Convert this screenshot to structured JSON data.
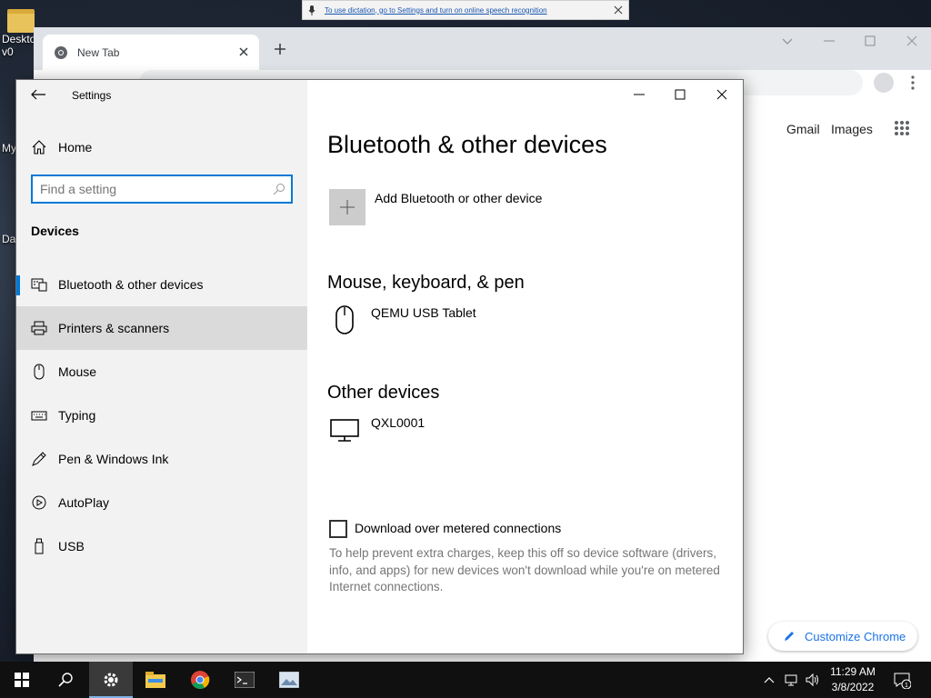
{
  "desktop": {
    "icons": [
      {
        "label": "Deskto\nv0"
      },
      {
        "label": "My"
      },
      {
        "label": "Da"
      }
    ]
  },
  "dictation_banner": {
    "text": "To use dictation, go to Settings and turn on online speech recognition"
  },
  "chrome": {
    "tab_title": "New Tab",
    "links": {
      "gmail": "Gmail",
      "images": "Images"
    },
    "customize_label": "Customize Chrome"
  },
  "settings": {
    "window_title": "Settings",
    "home_label": "Home",
    "search_placeholder": "Find a setting",
    "section_heading": "Devices",
    "nav": [
      {
        "label": "Bluetooth & other devices",
        "icon": "bluetooth-devices-icon"
      },
      {
        "label": "Printers & scanners",
        "icon": "printer-icon"
      },
      {
        "label": "Mouse",
        "icon": "mouse-icon"
      },
      {
        "label": "Typing",
        "icon": "keyboard-icon"
      },
      {
        "label": "Pen & Windows Ink",
        "icon": "pen-icon"
      },
      {
        "label": "AutoPlay",
        "icon": "autoplay-icon"
      },
      {
        "label": "USB",
        "icon": "usb-icon"
      }
    ],
    "page_title": "Bluetooth & other devices",
    "add_device_label": "Add Bluetooth or other device",
    "mouse_section": {
      "heading": "Mouse, keyboard, & pen",
      "device": "QEMU USB Tablet"
    },
    "other_section": {
      "heading": "Other devices",
      "device": "QXL0001"
    },
    "metered_checkbox_label": "Download over metered connections",
    "metered_checked": false,
    "help_text": "To help prevent extra charges, keep this off so device software (drivers, info, and apps) for new devices won't download while you're on metered Internet connections."
  },
  "taskbar": {
    "time": "11:29 AM",
    "date": "3/8/2022",
    "notification_count": "1"
  },
  "colors": {
    "accent": "#0078d7",
    "sidebar_bg": "#f2f2f2",
    "hover_bg": "#dadada",
    "taskbar_bg": "#101010"
  }
}
